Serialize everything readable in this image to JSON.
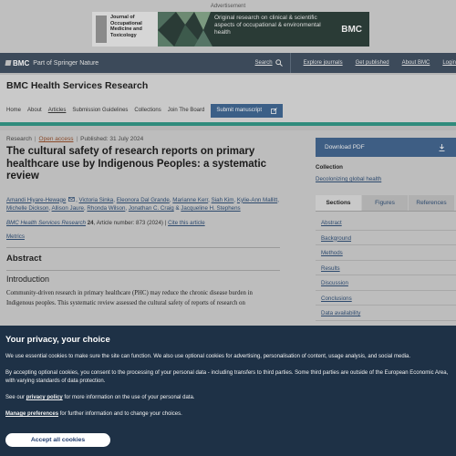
{
  "advertisement": {
    "label": "Advertisement",
    "journal_title": "Journal of Occupational Medicine and Toxicology",
    "tagline": "Original research on clinical & scientific aspects of occupational & environmental health",
    "logo": "BMC"
  },
  "topnav": {
    "brand": "BMC",
    "brand_suffix": "Part of Springer Nature",
    "search": "Search",
    "links": [
      "Explore journals",
      "Get published",
      "About BMC",
      "Login"
    ]
  },
  "journal": {
    "name": "BMC Health Services Research",
    "nav": [
      "Home",
      "About",
      "Articles",
      "Submission Guidelines",
      "Collections",
      "Join The Board"
    ],
    "submit": "Submit manuscript"
  },
  "article": {
    "type": "Research",
    "access": "Open access",
    "published": "Published: 31 July 2024",
    "title": "The cultural safety of research reports on primary healthcare use by Indigenous Peoples: a systematic review",
    "authors": [
      "Amandi Hiyare-Hewage",
      "Victoria Sinka",
      "Eleonora Dal Grande",
      "Marianne Kerr",
      "Siah Kim",
      "Kylie-Ann Mallitt",
      "Michelle Dickson",
      "Allison Jaure",
      "Rhonda Wilson",
      "Jonathan C. Craig",
      "Jacqueline H. Stephens"
    ],
    "journal_ref": "BMC Health Services Research",
    "volume": "24",
    "article_number": ", Article number: 873 (2024)",
    "cite": "Cite this article",
    "metrics": "Metrics",
    "abstract_heading": "Abstract",
    "intro_heading": "Introduction",
    "intro_text": "Community-driven research in primary healthcare (PHC) may reduce the chronic disease burden in Indigenous peoples. This systematic review assessed the cultural safety of reports of research on"
  },
  "sidebar": {
    "download": "Download PDF",
    "collection_heading": "Collection",
    "collection_link": "Decolonizing global health",
    "tabs": [
      "Sections",
      "Figures",
      "References"
    ],
    "sections": [
      "Abstract",
      "Background",
      "Methods",
      "Results",
      "Discussion",
      "Conclusions",
      "Data availability"
    ]
  },
  "privacy": {
    "heading": "Your privacy, your choice",
    "p1": "We use essential cookies to make sure the site can function. We also use optional cookies for advertising, personalisation of content, usage analysis, and social media.",
    "p2": "By accepting optional cookies, you consent to the processing of your personal data - including transfers to third parties. Some third parties are outside of the European Economic Area, with varying standards of data protection.",
    "p3_pre": "See our ",
    "p3_link": "privacy policy",
    "p3_post": " for more information on the use of your personal data.",
    "p4_link": "Manage preferences",
    "p4_post": " for further information and to change your choices.",
    "accept": "Accept all cookies"
  },
  "colors": {
    "overlay": "#1e3146",
    "accent_teal": "#2f8b7c",
    "button_blue": "#3e5e84"
  }
}
